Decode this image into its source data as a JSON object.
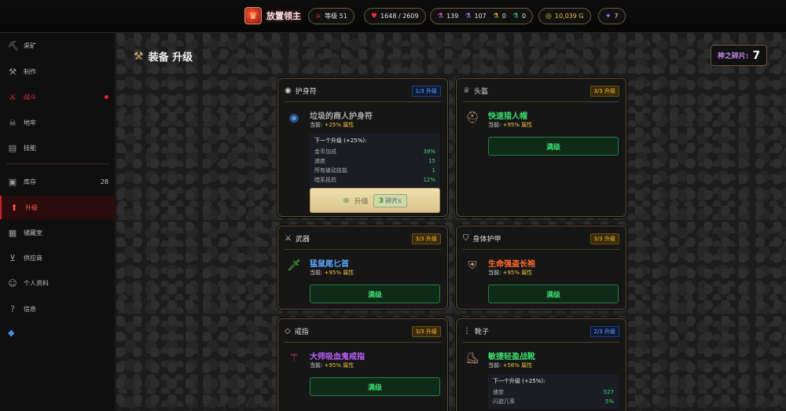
{
  "topbar": {
    "game_title": "放置领主",
    "level": "等级 51",
    "health": "1648 / 2609",
    "potions": [
      {
        "value": "139",
        "color": "#e05ac0"
      },
      {
        "value": "107",
        "color": "#b070ff"
      },
      {
        "value": "0",
        "color": "#e0b030"
      },
      {
        "value": "0",
        "color": "#30c070"
      }
    ],
    "gold": "10,039 G",
    "shards_small": "7"
  },
  "sidebar": {
    "items": [
      {
        "label": "采矿",
        "icon": "pickaxe-icon"
      },
      {
        "label": "制作",
        "icon": "hammer-icon"
      },
      {
        "label": "战斗",
        "icon": "sword-icon"
      },
      {
        "label": "地牢",
        "icon": "skull-icon"
      },
      {
        "label": "技能",
        "icon": "book-icon"
      },
      {
        "label": "库存",
        "icon": "box-icon",
        "badge": "28"
      },
      {
        "label": "升级",
        "icon": "arrow-up-circle-icon"
      },
      {
        "label": "储藏室",
        "icon": "archive-icon"
      },
      {
        "label": "供应商",
        "icon": "cart-icon"
      },
      {
        "label": "个人资料",
        "icon": "user-icon"
      },
      {
        "label": "信息",
        "icon": "help-circle-icon"
      }
    ]
  },
  "page": {
    "title": "装备 升级",
    "shards_label": "神之碎片:",
    "shards_value": "7"
  },
  "cards": {
    "amulet": {
      "slot": "护身符",
      "level": "1/3 升级",
      "item_name": "垃圾的商人护身符",
      "item_color": "#aaaaaa",
      "current": "当前:",
      "current_bonus": "+25% 属性",
      "next_title": "下一个升级 (+25%):",
      "stats": [
        {
          "name": "金币加成",
          "value": "39%"
        },
        {
          "name": "速度",
          "value": "15"
        },
        {
          "name": "所有被动技能",
          "value": "1"
        },
        {
          "name": "暗系抵抗",
          "value": "12%"
        }
      ],
      "upgrade_label": "升级",
      "cost_value": "3",
      "cost_unit": "碎片s"
    },
    "helmet": {
      "slot": "头盔",
      "level": "3/3 升级",
      "item_name": "快速猎人帽",
      "item_color": "#3ddc6f",
      "current": "当前:",
      "current_bonus": "+95% 属性",
      "button": "满级"
    },
    "weapon": {
      "slot": "武器",
      "level": "3/3 升级",
      "item_name": "猛鼠尾匕首",
      "item_color": "#5aa8ff",
      "current": "当前:",
      "current_bonus": "+95% 属性",
      "button": "满级"
    },
    "armor": {
      "slot": "身体护甲",
      "level": "3/3 升级",
      "item_name": "生命强盗长袍",
      "item_color": "#ff6a30",
      "current": "当前:",
      "current_bonus": "+95% 属性",
      "button": "满级"
    },
    "ring": {
      "slot": "戒指",
      "level": "3/3 升级",
      "item_name": "大师吸血鬼戒指",
      "item_color": "#c060ff",
      "current": "当前:",
      "current_bonus": "+95% 属性",
      "button": "满级"
    },
    "boots": {
      "slot": "靴子",
      "level": "2/3 升级",
      "item_name": "敏捷轻盈战靴",
      "item_color": "#3ddc6f",
      "current": "当前:",
      "current_bonus": "+56% 属性",
      "next_title": "下一个升级 (+25%):",
      "stats": [
        {
          "name": "速度",
          "value": "527"
        },
        {
          "name": "闪避几率",
          "value": "5%"
        }
      ]
    }
  }
}
